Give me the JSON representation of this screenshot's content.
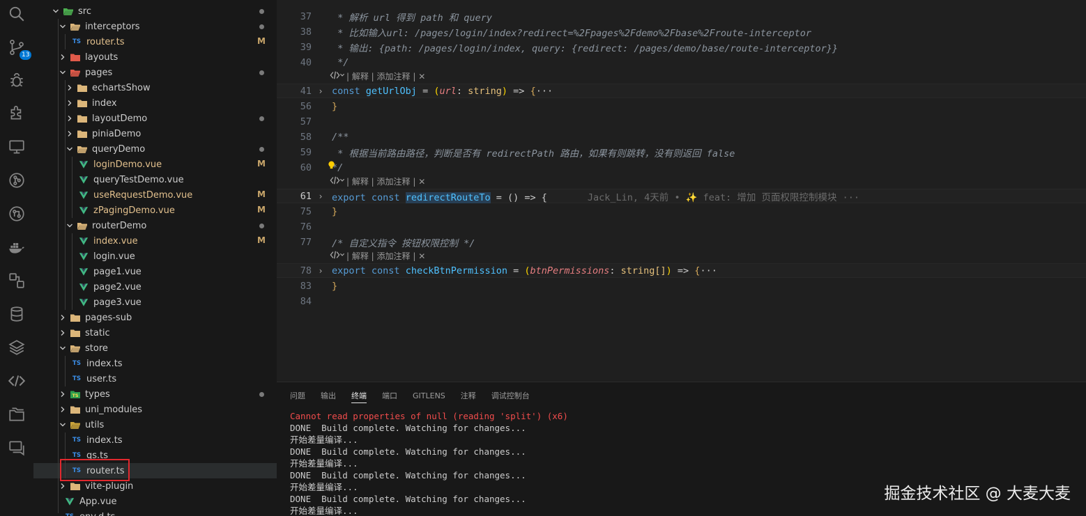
{
  "activity_bar": {
    "icons": [
      "search-icon",
      "source-control-icon",
      "debug-icon",
      "extensions-icon",
      "remote-explorer-icon",
      "gitlens-icon",
      "git-graph-icon",
      "docker-icon",
      "modules-icon",
      "database-icon",
      "layers-icon",
      "code-icon",
      "folders-icon",
      "chat-icon"
    ],
    "source_control_badge": "13"
  },
  "explorer": {
    "items": [
      {
        "label": "src",
        "type": "folder-src",
        "state": "open",
        "marker": "dot"
      },
      {
        "label": "interceptors",
        "type": "folder",
        "state": "open",
        "marker": "dot"
      },
      {
        "label": "router.ts",
        "type": "ts",
        "marker": "M"
      },
      {
        "label": "layouts",
        "type": "folder-special",
        "state": "closed"
      },
      {
        "label": "pages",
        "type": "folder-special",
        "state": "open",
        "marker": "dot"
      },
      {
        "label": "echartsShow",
        "type": "folder",
        "state": "closed"
      },
      {
        "label": "index",
        "type": "folder",
        "state": "closed"
      },
      {
        "label": "layoutDemo",
        "type": "folder",
        "state": "closed",
        "marker": "dot"
      },
      {
        "label": "piniaDemo",
        "type": "folder",
        "state": "closed"
      },
      {
        "label": "queryDemo",
        "type": "folder",
        "state": "open",
        "marker": "dot"
      },
      {
        "label": "loginDemo.vue",
        "type": "vue",
        "marker": "M"
      },
      {
        "label": "queryTestDemo.vue",
        "type": "vue"
      },
      {
        "label": "useRequestDemo.vue",
        "type": "vue",
        "marker": "M"
      },
      {
        "label": "zPagingDemo.vue",
        "type": "vue",
        "marker": "M"
      },
      {
        "label": "routerDemo",
        "type": "folder",
        "state": "open",
        "marker": "dot"
      },
      {
        "label": "index.vue",
        "type": "vue",
        "marker": "M"
      },
      {
        "label": "login.vue",
        "type": "vue"
      },
      {
        "label": "page1.vue",
        "type": "vue"
      },
      {
        "label": "page2.vue",
        "type": "vue"
      },
      {
        "label": "page3.vue",
        "type": "vue"
      },
      {
        "label": "pages-sub",
        "type": "folder",
        "state": "closed"
      },
      {
        "label": "static",
        "type": "folder",
        "state": "closed"
      },
      {
        "label": "store",
        "type": "folder",
        "state": "open"
      },
      {
        "label": "index.ts",
        "type": "ts"
      },
      {
        "label": "user.ts",
        "type": "ts"
      },
      {
        "label": "types",
        "type": "folder-ts",
        "state": "closed",
        "marker": "dot"
      },
      {
        "label": "uni_modules",
        "type": "folder",
        "state": "closed"
      },
      {
        "label": "utils",
        "type": "folder-utils",
        "state": "open"
      },
      {
        "label": "index.ts",
        "type": "ts"
      },
      {
        "label": "qs.ts",
        "type": "ts"
      },
      {
        "label": "router.ts",
        "type": "ts",
        "selected": true
      },
      {
        "label": "vite-plugin",
        "type": "folder",
        "state": "closed"
      },
      {
        "label": "App.vue",
        "type": "vue"
      },
      {
        "label": "env.d.ts",
        "type": "ts"
      }
    ],
    "file_icon_text": {
      "ts": "TS",
      "vue": "V"
    }
  },
  "editor": {
    "lines": [
      {
        "n": "37",
        "text": " * 解析 url 得到 path 和 query"
      },
      {
        "n": "38",
        "text": " * 比如输入url: /pages/login/index?redirect=%2Fpages%2Fdemo%2Fbase%2Froute-interceptor"
      },
      {
        "n": "39",
        "text": " * 输出: {path: /pages/login/index, query: {redirect: /pages/demo/base/route-interceptor}}"
      },
      {
        "n": "40",
        "text": " */"
      },
      {
        "n": "41",
        "kw": "const",
        "name": "getUrlObj",
        "mid": " = ",
        "p1": "(",
        "param": "url",
        "colon": ": ",
        "ptype": "string",
        "p2": ")",
        "arrow": " => ",
        "brace": "{",
        "tail": "···"
      },
      {
        "n": "56",
        "text": "}"
      },
      {
        "n": "57",
        "text": ""
      },
      {
        "n": "58",
        "text": "/**"
      },
      {
        "n": "59",
        "text": " * 根据当前路由路径，判断是否有 redirectPath 路由，如果有则跳转，没有则返回 false"
      },
      {
        "n": "60",
        "text": "*/"
      },
      {
        "n": "61",
        "kw1": "export",
        "kw2": "const",
        "name": "redirectRouteTo",
        "rest": " = () => {",
        "blame": "Jack_Lin, 4天前 • ✨ feat: 增加 页面权限控制模块 ···"
      },
      {
        "n": "75",
        "text": "}"
      },
      {
        "n": "76",
        "text": ""
      },
      {
        "n": "77",
        "text": "/* 自定义指令 按钮权限控制 */"
      },
      {
        "n": "78",
        "kw1": "export",
        "kw2": "const",
        "name": "checkBtnPermission",
        "mid": " = ",
        "p1": "(",
        "param": "btnPermissions",
        "colon": ": ",
        "ptype": "string[]",
        "p2": ")",
        "arrow": " => ",
        "brace": "{",
        "tail": "···"
      },
      {
        "n": "83",
        "text": "}"
      },
      {
        "n": "84",
        "text": ""
      }
    ],
    "codelens": " | 解释 | 添加注释 | ✕"
  },
  "panel": {
    "tabs": [
      "问题",
      "输出",
      "终端",
      "端口",
      "GITLENS",
      "注释",
      "调试控制台"
    ],
    "active_tab": "终端",
    "terminal": [
      {
        "text": "Cannot read properties of null (reading 'split') (x6)",
        "kind": "err"
      },
      {
        "text": "DONE  Build complete. Watching for changes..."
      },
      {
        "text": "开始差量编译..."
      },
      {
        "text": "DONE  Build complete. Watching for changes..."
      },
      {
        "text": "开始差量编译..."
      },
      {
        "text": "DONE  Build complete. Watching for changes..."
      },
      {
        "text": "开始差量编译..."
      },
      {
        "text": "DONE  Build complete. Watching for changes..."
      },
      {
        "text": "开始差量编译..."
      }
    ]
  },
  "watermark": "掘金技术社区 @ 大麦大麦",
  "colors": {
    "accent": "#0078d4",
    "highlight_box": "#e2282e",
    "folder": "#dcb67a"
  }
}
